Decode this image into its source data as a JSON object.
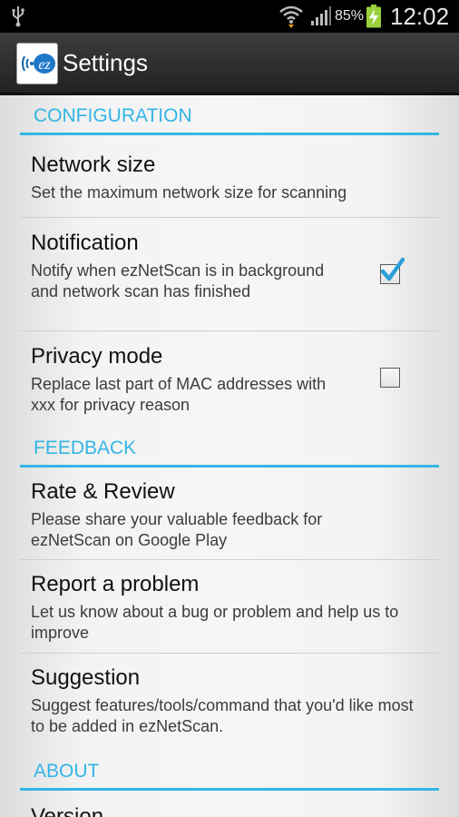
{
  "status_bar": {
    "battery": "85%",
    "time": "12:02"
  },
  "action_bar": {
    "title": "Settings",
    "icon_text": "ez"
  },
  "sections": {
    "configuration": {
      "header": "CONFIGURATION",
      "network_size": {
        "title": "Network size",
        "summary": "Set the maximum network size for scanning"
      },
      "notification": {
        "title": "Notification",
        "summary": "Notify when ezNetScan is in background and network scan has finished",
        "checked": true
      },
      "privacy": {
        "title": "Privacy mode",
        "summary": "Replace last part of MAC addresses with xxx for privacy reason",
        "checked": false
      }
    },
    "feedback": {
      "header": "FEEDBACK",
      "rate": {
        "title": "Rate & Review",
        "summary": "Please share your valuable feedback for ezNetScan on Google Play"
      },
      "report": {
        "title": "Report a problem",
        "summary": "Let us know about a bug or problem and help us to improve"
      },
      "suggestion": {
        "title": "Suggestion",
        "summary": "Suggest features/tools/command that you'd like most to be added in ezNetScan."
      }
    },
    "about": {
      "header": "ABOUT",
      "version": {
        "title": "Version"
      }
    }
  },
  "colors": {
    "accent": "#33b5e5",
    "checkmark": "#2a9fd6"
  }
}
